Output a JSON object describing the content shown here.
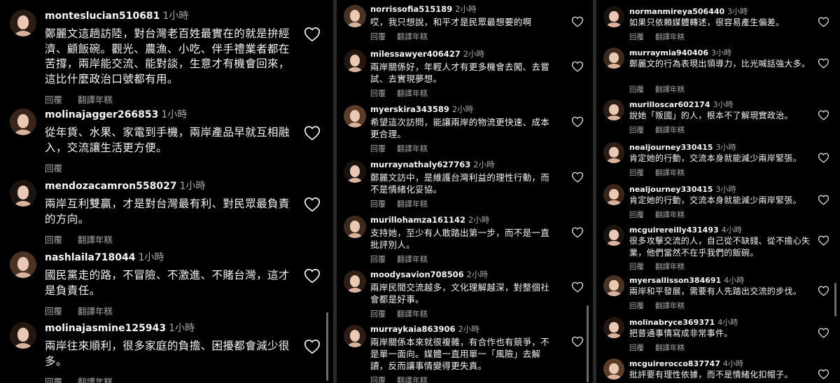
{
  "labels": {
    "reply": "回覆",
    "translate": "翻譯年糕"
  },
  "colors": {
    "background": "#000000",
    "muted": "#a8a8a8",
    "text": "#f5f5f5"
  },
  "panels": [
    {
      "comments": [
        {
          "user": "monteslucian510681",
          "time": "1小時",
          "text": "鄭麗文這趟訪陸，對台灣老百姓最實在的就是拚經濟、顧飯碗。觀光、農漁、小吃、伴手禮業者都在苦撐，兩岸能交流、能對談，生意才有機會回來，這比什麼政治口號都有用。",
          "translate": true
        },
        {
          "user": "molinajagger266853",
          "time": "1小時",
          "text": "從年貨、水果、家電到手機，兩岸產品早就互相融入，交流讓生活更方便。",
          "translate": false
        },
        {
          "user": "mendozacamron558027",
          "time": "1小時",
          "text": "兩岸互利雙贏，才是對台灣最有利、對民眾最負責的方向。",
          "translate": true
        },
        {
          "user": "nashlaila718044",
          "time": "1小時",
          "text": "國民黨走的路，不冒險、不激進、不賭台灣，這才是負責任。",
          "translate": true
        },
        {
          "user": "molinajasmine125943",
          "time": "1小時",
          "text": "兩岸往來順利，很多家庭的負擔、困擾都會減少很多。",
          "translate": true
        }
      ]
    },
    {
      "comments": [
        {
          "user": "norrissofia515189",
          "time": "2小時",
          "text": "哎，我只想說，和平才是民眾最想要的啊",
          "translate": true
        },
        {
          "user": "milessawyer406427",
          "time": "2小時",
          "text": "兩岸關係好，年輕人才有更多機會去闖、去嘗試、去實現夢想。",
          "translate": true
        },
        {
          "user": "myerskira343589",
          "time": "2小時",
          "text": "希望這次訪問，能讓兩岸的物流更快速、成本更合理。",
          "translate": true
        },
        {
          "user": "murraynathaly627763",
          "time": "2小時",
          "text": "鄭麗文訪中，是維護台灣利益的理性行動，而不是情緒化妥協。",
          "translate": true
        },
        {
          "user": "murillohamza161142",
          "time": "2小時",
          "text": "支持她，至少有人敢踏出第一步，而不是一直批評別人。",
          "translate": true
        },
        {
          "user": "moodysavion708506",
          "time": "2小時",
          "text": "兩岸民間交流越多，文化理解越深，對整個社會都是好事。",
          "translate": true
        },
        {
          "user": "murraykaia863906",
          "time": "2小時",
          "text": "兩岸關係本來就很複雜，有合作也有競爭，不是單一面向。媒體一直用單一「風險」去解讀，反而讓事情變得更失真。",
          "translate": true
        }
      ]
    },
    {
      "comments": [
        {
          "user": "normanmireya506440",
          "time": "3小時",
          "text": "如果只依賴媒體轉述，很容易產生偏差。",
          "translate": true
        },
        {
          "user": "murraymia940406",
          "time": "3小時",
          "text": "鄭麗文的行為表現出領導力，比光喊話強大多。",
          "translate": true
        },
        {
          "user": "murilloscar602174",
          "time": "3小時",
          "text": "說她「叛國」的人，根本不了解現實政治。",
          "translate": true
        },
        {
          "user": "nealjourney330415",
          "time": "3小時",
          "text": "肯定她的行動，交流本身就能減少兩岸緊張。",
          "translate": true
        },
        {
          "user": "nealjourney330415",
          "time": "3小時",
          "text": "肯定她的行動，交流本身就能減少兩岸緊張。",
          "translate": true
        },
        {
          "user": "mcguirereilly431493",
          "time": "4小時",
          "text": "很多攻擊交流的人，自己從不缺錢、從不擔心失業，他們當然不在乎我們的飯碗。",
          "translate": true
        },
        {
          "user": "myersallisson384691",
          "time": "4小時",
          "text": "兩岸和平發展，需要有人先踏出交流的步伐。",
          "translate": true
        },
        {
          "user": "molinabryce369371",
          "time": "4小時",
          "text": "把普通事情寫成非常事件。",
          "translate": true
        },
        {
          "user": "mcguirerocco837747",
          "time": "4小時",
          "text": "批評要有理性依據，而不是情緒化扣帽子。",
          "translate": false
        }
      ]
    }
  ]
}
